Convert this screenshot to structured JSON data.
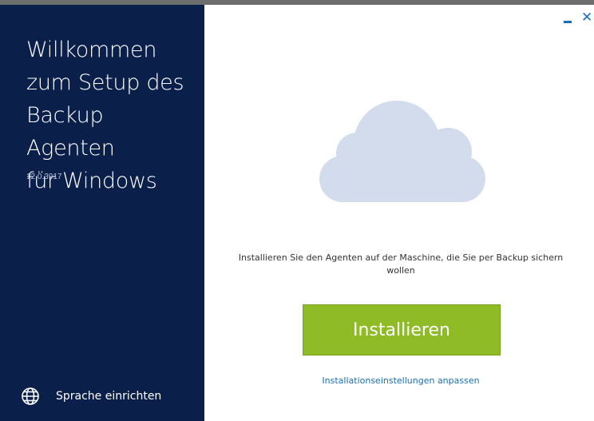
{
  "window": {
    "minimize_icon": "minimize-icon",
    "close_icon": "close-icon",
    "accent_color": "#1a6fb4"
  },
  "sidebar": {
    "title": "Willkommen\nzum Setup des\nBackup Agenten\nfür Windows",
    "version": "12.0.3917",
    "language_icon": "globe-icon",
    "language_label": "Sprache einrichten",
    "background_color": "#0b1f4b"
  },
  "main": {
    "illustration_icon": "cloud-icon",
    "message": "Installieren Sie den Agenten auf der Maschine, die Sie per Backup sichern wollen",
    "install_button_label": "Installieren",
    "install_button_color": "#8ebb26",
    "settings_link_label": "Installationseinstellungen anpassen"
  }
}
